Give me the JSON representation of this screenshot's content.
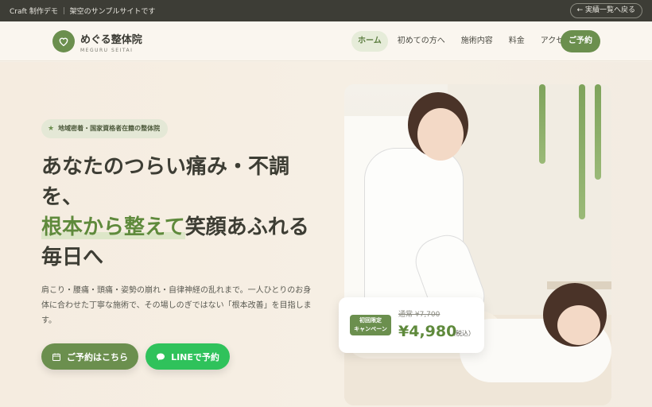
{
  "topbar": {
    "demo_label": "Craft 制作デモ ｜ 架空のサンプルサイトです",
    "back_label": "← 実績一覧へ戻る"
  },
  "header": {
    "logo_name": "めぐる整体院",
    "logo_sub": "MEGURU SEITAI",
    "nav": [
      {
        "label": "ホーム",
        "active": true
      },
      {
        "label": "初めての方へ"
      },
      {
        "label": "施術内容"
      },
      {
        "label": "料金"
      },
      {
        "label": "アクセス"
      }
    ],
    "reserve_label": "ご予約"
  },
  "hero": {
    "badge": "地域密着・国家資格者在籍の整体院",
    "headline_line1": "あなたのつらい痛み・不調",
    "headline_line2": "を、",
    "headline_highlight": "根本から整えて",
    "headline_line3_rest": "笑顔あふれる",
    "headline_line4": "毎日へ",
    "lead": "肩こり・腰痛・頭痛・姿勢の崩れ・自律神経の乱れまで。一人ひとりのお身体に合わせた丁寧な施術で、その場しのぎではない「根本改善」を目指します。",
    "btn_reserve": "ご予約はこちら",
    "btn_line": "LINEで予約"
  },
  "price": {
    "tag_line1": "初回限定",
    "tag_line2": "キャンペーン",
    "old": "通常 ¥7,700",
    "new": "¥4,980",
    "tax": "（税込）"
  },
  "colors": {
    "brand_green": "#6b8f4e",
    "line_green": "#2fc25b",
    "topbar": "#3d3d36",
    "background": "#f7f1e8"
  }
}
